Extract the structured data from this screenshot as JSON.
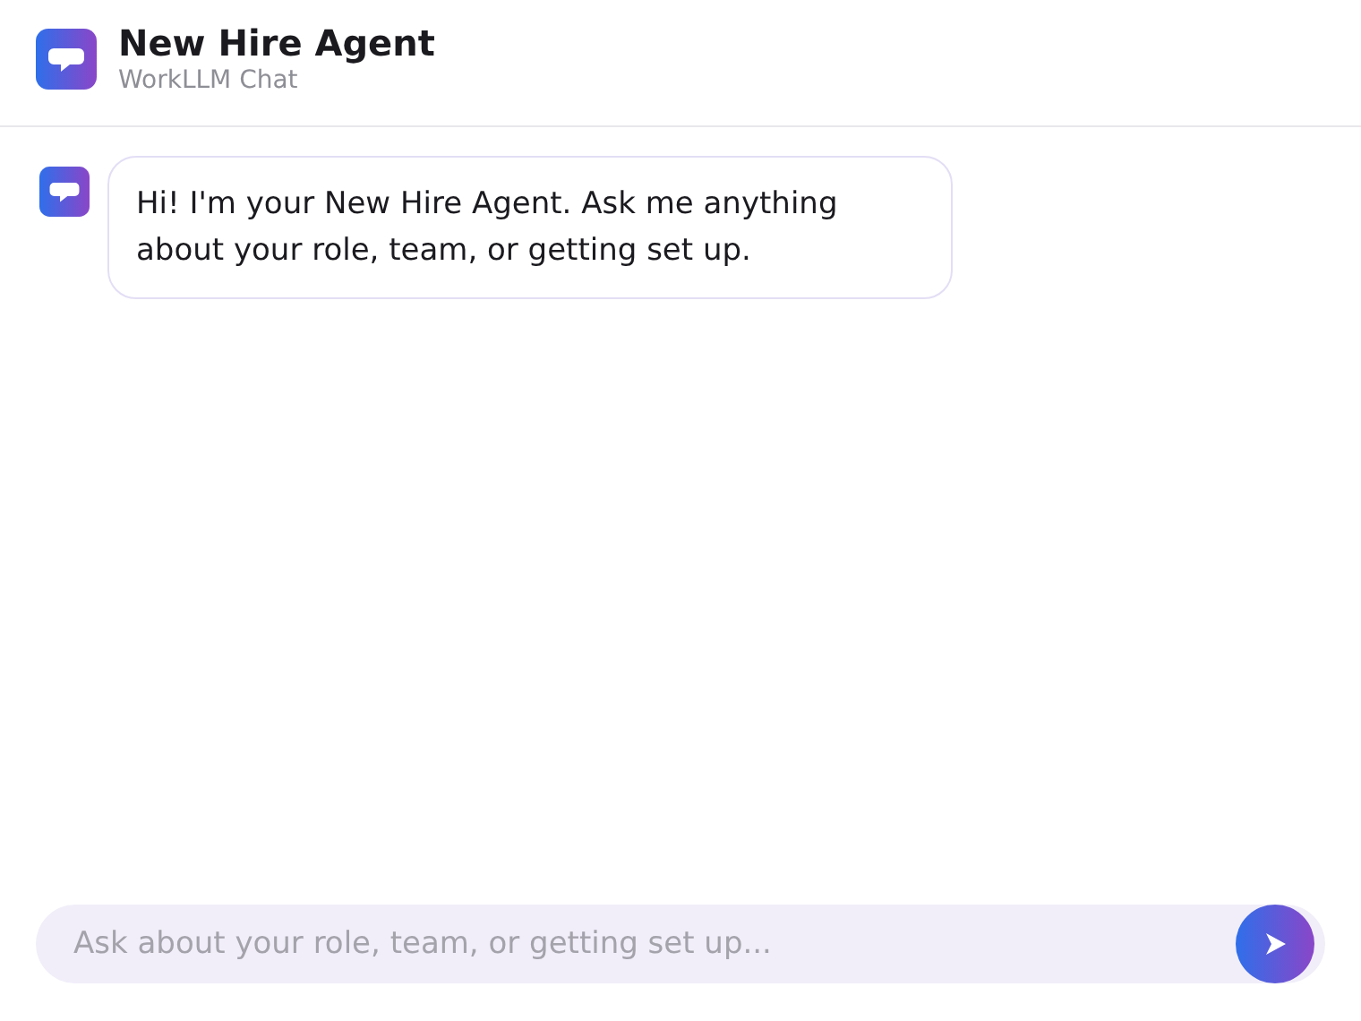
{
  "header": {
    "title": "New Hire Agent",
    "subtitle": "WorkLLM Chat"
  },
  "messages": [
    {
      "kind": "agent",
      "text": "Hi! I'm your New Hire Agent. Ask me anything about your role, team, or getting set up."
    }
  ],
  "composer": {
    "placeholder": "Ask about your role, team, or getting set up..."
  }
}
